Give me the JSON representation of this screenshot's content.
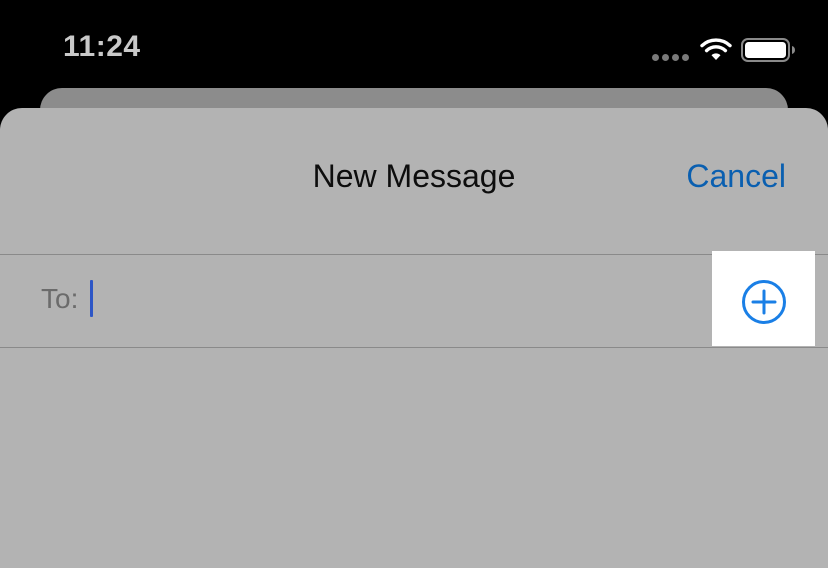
{
  "status_bar": {
    "time": "11:24",
    "signal_icon": "cellular-signal-dots-icon",
    "wifi_icon": "wifi-icon",
    "battery_icon": "battery-icon"
  },
  "compose": {
    "title": "New Message",
    "cancel_label": "Cancel",
    "to_label": "To:",
    "to_value": "",
    "add_contact_icon": "plus-circle-icon"
  },
  "colors": {
    "accent": "#0a5fb0",
    "caret": "#2d56c6",
    "sheet_background": "#b3b3b3",
    "status_bar_background": "#000000"
  }
}
